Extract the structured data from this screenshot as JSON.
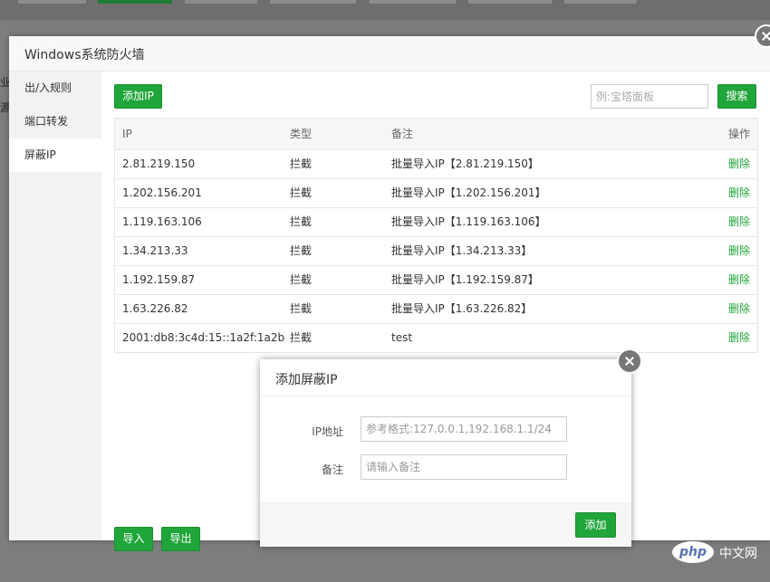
{
  "background": {
    "side_texts": [
      "业",
      "源"
    ]
  },
  "main_dialog": {
    "title": "Windows系统防火墙",
    "sidebar": [
      "出/入规则",
      "端口转发",
      "屏蔽IP"
    ],
    "add_ip_label": "添加IP",
    "search_placeholder": "例:宝塔面板",
    "search_label": "搜索",
    "table": {
      "headers": {
        "ip": "IP",
        "type": "类型",
        "note": "备注",
        "op": "操作"
      },
      "rows": [
        {
          "ip": "2.81.219.150",
          "type": "拦截",
          "note": "批量导入IP【2.81.219.150】",
          "op": "删除"
        },
        {
          "ip": "1.202.156.201",
          "type": "拦截",
          "note": "批量导入IP【1.202.156.201】",
          "op": "删除"
        },
        {
          "ip": "1.119.163.106",
          "type": "拦截",
          "note": "批量导入IP【1.119.163.106】",
          "op": "删除"
        },
        {
          "ip": "1.34.213.33",
          "type": "拦截",
          "note": "批量导入IP【1.34.213.33】",
          "op": "删除"
        },
        {
          "ip": "1.192.159.87",
          "type": "拦截",
          "note": "批量导入IP【1.192.159.87】",
          "op": "删除"
        },
        {
          "ip": "1.63.226.82",
          "type": "拦截",
          "note": "批量导入IP【1.63.226.82】",
          "op": "删除"
        },
        {
          "ip": "2001:db8:3c4d:15::1a2f:1a2b",
          "type": "拦截",
          "note": "test",
          "op": "删除"
        }
      ]
    },
    "import_label": "导入",
    "export_label": "导出"
  },
  "sub_dialog": {
    "title": "添加屏蔽IP",
    "ip_label": "IP地址",
    "ip_placeholder": "参考格式:127.0.0.1,192.168.1.1/24",
    "note_label": "备注",
    "note_placeholder": "请输入备注",
    "confirm_label": "添加"
  },
  "watermark": {
    "logo": "php",
    "text": "中文网"
  },
  "colors": {
    "accent": "#20a53a",
    "overlay": "#7d7d7d"
  }
}
